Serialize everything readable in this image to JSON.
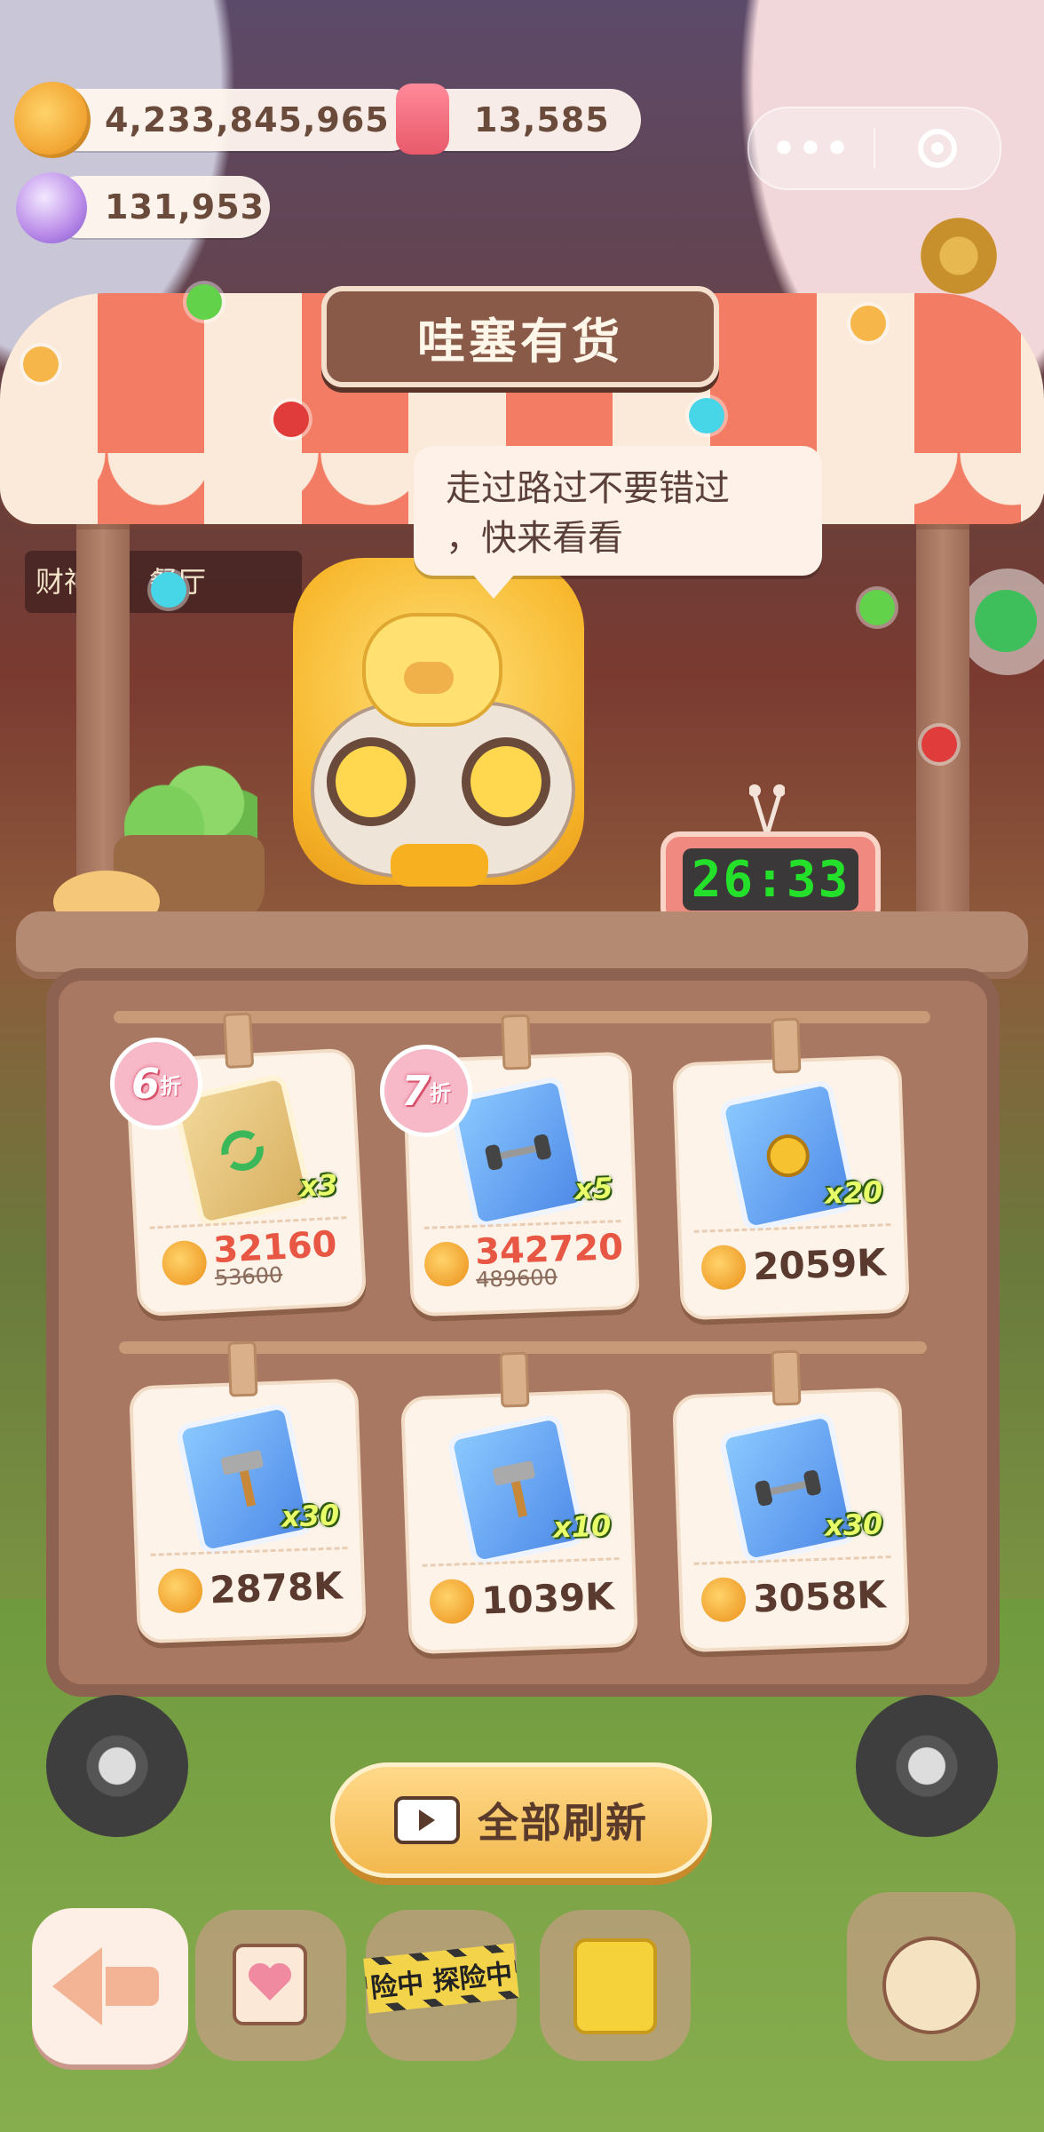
{
  "currencies": {
    "coins": "4,233,845,965",
    "candles": "13,585",
    "gems": "131,953"
  },
  "capsule": {
    "more_label": "•••"
  },
  "background": {
    "sign_text": "财神在　餐厅"
  },
  "shop": {
    "title": "哇塞有货",
    "speech_line1": "走过路过不要错过",
    "speech_line2": "，快来看看",
    "timer": "26:33"
  },
  "items": [
    {
      "discount": "6",
      "discount_suffix": "折",
      "icon": "bag-icon",
      "qty": "x3",
      "price": "32160",
      "old_price": "53600"
    },
    {
      "discount": "7",
      "discount_suffix": "折",
      "icon": "dumbbell-card-icon",
      "qty": "x5",
      "price": "342720",
      "old_price": "489600"
    },
    {
      "icon": "fist-card-icon",
      "qty": "x20",
      "price": "2059K"
    },
    {
      "icon": "hammer-card-icon",
      "qty": "x30",
      "price": "2878K"
    },
    {
      "icon": "hammer-card-icon",
      "qty": "x10",
      "price": "1039K"
    },
    {
      "icon": "dumbbell-card-icon",
      "qty": "x30",
      "price": "3058K"
    }
  ],
  "refresh_button": {
    "label": "全部刷新"
  },
  "bottom_bar": {
    "tape_text": "险中 探险中"
  },
  "colors": {
    "accent": "#f27c64",
    "timer_text": "#24e02a",
    "discount_price": "#e85644"
  }
}
